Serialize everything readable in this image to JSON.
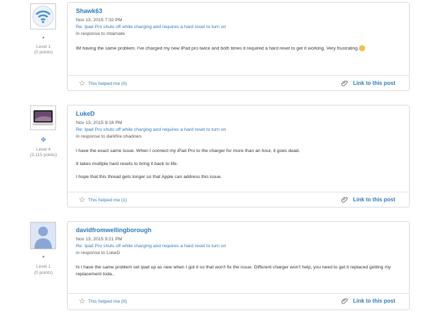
{
  "posts": [
    {
      "username": "Shawk63",
      "date": "Nov 13, 2015 7:32 PM",
      "thread": "Re: Ipad Pro shuts off while charging and requires a hard reset to turn on",
      "in_response": "in response to mtarnate",
      "level": "Level 1",
      "points": "(0 points)",
      "avatar_icon": "wifi-icon",
      "body": [
        "IM having the same problem. I've charged my new iPad pro twice and both times it required a hard reset to get it working. Very frustrating."
      ],
      "helped": "This helped me (0)",
      "link": "Link to this post"
    },
    {
      "username": "LukeD",
      "date": "Nov 13, 2015 8:18 PM",
      "thread": "Re: Ipad Pro shuts off while charging and requires a hard reset to turn on",
      "in_response": "in response to darkfire.shadows",
      "level": "Level 4",
      "points": "(3,115 points)",
      "avatar_icon": "laptop-icon",
      "body": [
        "I have the exact same issue. When I connect my iPad Pro to the charger for more than an hour, it goes dead.",
        "It takes multiple hard resets to bring it back to life.",
        "I hope that this thread gets longer so that Apple can address this issue."
      ],
      "helped": "This helped me (1)",
      "link": "Link to this post"
    },
    {
      "username": "davidfromwellingborough",
      "date": "Nov 13, 2015 9:21 PM",
      "thread": "Re: Ipad Pro shuts off while charging and requires a hard reset to turn on",
      "in_response": "in response to LukeD",
      "level": "Level 1",
      "points": "(0 points)",
      "avatar_icon": "user-silhouette-icon",
      "body": [
        "hi I have the same problem set ipad up as new when I got it so that won't fix the issue. Different charger won't help, you need to get it replaced getting my replacement toda.."
      ],
      "helped": "This helped me (0)",
      "link": "Link to this post"
    }
  ]
}
